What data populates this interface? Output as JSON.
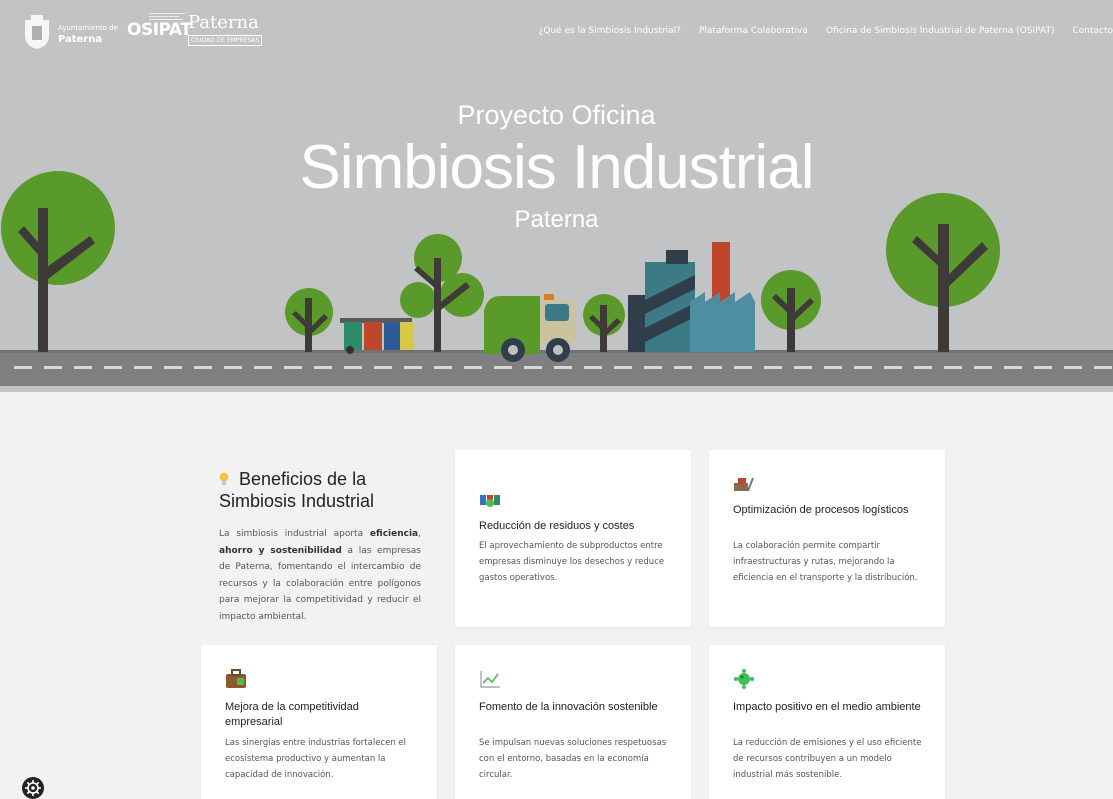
{
  "nav": {
    "ayuntamiento_line1": "Ayuntamiento de",
    "ayuntamiento_line2": "Paterna",
    "osipat_logo": "OSIPAT",
    "paterna_logo": "Paterna",
    "paterna_sub": "CIUDAD DE EMPRESAS",
    "menu": [
      "¿Qué es la Simbiosis Industrial?",
      "Plataforma Colaborativa",
      "Oficina de Simbiosis Industrial de Paterna (OSIPAT)",
      "Contacto"
    ]
  },
  "hero": {
    "line1": "Proyecto Oficina",
    "line2": "Simbiosis Industrial",
    "line3": "Paterna"
  },
  "intro": {
    "title": "Beneficios de la Simbiosis Industrial",
    "text_before": "La simbiosis industrial aporta ",
    "bold1": "eficiencia",
    "sep": ", ",
    "bold2": "ahorro y sostenibilidad",
    "text_after": " a las empresas de Paterna, fomentando el intercambio de recursos y la colaboración entre polígonos para mejorar la competitividad y reducir el impacto ambiental."
  },
  "cards": [
    {
      "icon": "recycle-bins-icon",
      "title": "Reducción de residuos y costes",
      "text": "El aprovechamiento de subproductos entre empresas disminuye los desechos y reduce gastos operativos."
    },
    {
      "icon": "logistics-cart-icon",
      "title": "Optimización de procesos logísticos",
      "text": "La colaboración permite compartir infraestructuras y rutas, mejorando la eficiencia en el transporte y la distribución."
    },
    {
      "icon": "briefcase-icon",
      "title": "Mejora de la competitividad empresarial",
      "text": "Las sinergias entre industrias fortalecen el ecosistema productivo y aumentan la capacidad de innovación."
    },
    {
      "icon": "chart-line-icon",
      "title": "Fomento de la innovación sostenible",
      "text": "Se impulsan nuevas soluciones respetuosas con el entorno, basadas en la economía circular."
    },
    {
      "icon": "microbe-icon",
      "title": "Impacto positivo en el medio ambiente",
      "text": "La reducción de emisiones y el uso eficiente de recursos contribuyen a un modelo industrial más sostenible."
    }
  ],
  "colors": {
    "hero_bg": "#c2c3c4",
    "road": "#7d7f80",
    "tree_green": "#5a9a2a",
    "trunk": "#3e3a38",
    "factory_teal": "#3c7a85",
    "chimney_red": "#c0462b",
    "page_bg": "#f2f2f2"
  }
}
